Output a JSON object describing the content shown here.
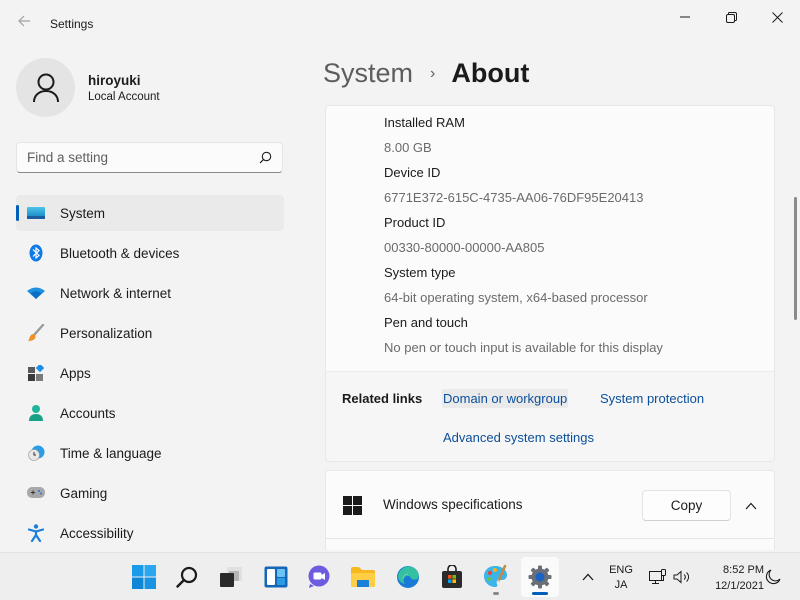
{
  "window": {
    "title": "Settings",
    "back_icon": "arrow-left-icon",
    "controls": {
      "minimize": "minimize-icon",
      "maximize": "restore-icon",
      "close": "close-icon"
    }
  },
  "profile": {
    "name": "hiroyuki",
    "account_type": "Local Account",
    "avatar_icon": "person-icon"
  },
  "search": {
    "placeholder": "Find a setting",
    "value": "",
    "icon": "search-icon"
  },
  "sidebar": {
    "items": [
      {
        "label": "System",
        "icon": "system-monitor-icon",
        "active": true
      },
      {
        "label": "Bluetooth & devices",
        "icon": "bluetooth-icon",
        "active": false
      },
      {
        "label": "Network & internet",
        "icon": "wifi-icon",
        "active": false
      },
      {
        "label": "Personalization",
        "icon": "paintbrush-icon",
        "active": false
      },
      {
        "label": "Apps",
        "icon": "apps-icon",
        "active": false
      },
      {
        "label": "Accounts",
        "icon": "accounts-icon",
        "active": false
      },
      {
        "label": "Time & language",
        "icon": "time-globe-icon",
        "active": false
      },
      {
        "label": "Gaming",
        "icon": "gamepad-icon",
        "active": false
      },
      {
        "label": "Accessibility",
        "icon": "accessibility-icon",
        "active": false
      }
    ]
  },
  "breadcrumb": {
    "parent": "System",
    "separator": "›",
    "current": "About"
  },
  "device_specs": [
    {
      "label": "Installed RAM",
      "value": "8.00 GB"
    },
    {
      "label": "Device ID",
      "value": "6771E372-615C-4735-AA06-76DF95E20413"
    },
    {
      "label": "Product ID",
      "value": "00330-80000-00000-AA805"
    },
    {
      "label": "System type",
      "value": "64-bit operating system, x64-based processor"
    },
    {
      "label": "Pen and touch",
      "value": "No pen or touch input is available for this display"
    }
  ],
  "related_links": {
    "label": "Related links",
    "links": [
      {
        "label": "Domain or workgroup",
        "hovered": true
      },
      {
        "label": "System protection",
        "hovered": false
      },
      {
        "label": "Advanced system settings",
        "hovered": false
      }
    ]
  },
  "windows_specifications": {
    "label": "Windows specifications",
    "icon": "windows-logo-icon",
    "copy_label": "Copy",
    "expanded": true,
    "collapse_icon": "chevron-up-icon"
  },
  "taskbar": {
    "apps": [
      {
        "name": "Start",
        "icon": "windows-start-icon",
        "state": "none"
      },
      {
        "name": "Search",
        "icon": "search-icon",
        "state": "none"
      },
      {
        "name": "Task View",
        "icon": "task-view-icon",
        "state": "none"
      },
      {
        "name": "Widgets",
        "icon": "widgets-icon",
        "state": "none"
      },
      {
        "name": "Chat",
        "icon": "teams-chat-icon",
        "state": "none"
      },
      {
        "name": "File Explorer",
        "icon": "folder-icon",
        "state": "none"
      },
      {
        "name": "Microsoft Edge",
        "icon": "edge-icon",
        "state": "none"
      },
      {
        "name": "Microsoft Store",
        "icon": "store-icon",
        "state": "none"
      },
      {
        "name": "Paint",
        "icon": "paint-palette-icon",
        "state": "running"
      },
      {
        "name": "Settings",
        "icon": "settings-gear-icon",
        "state": "focused"
      }
    ],
    "tray": {
      "overflow_icon": "chevron-up-icon",
      "ime_line1": "ENG",
      "ime_line2": "JA",
      "network_icon": "network-wired-icon",
      "volume_icon": "volume-icon",
      "time": "8:52 PM",
      "date": "12/1/2021",
      "focus_icon": "moon-icon"
    }
  },
  "colors": {
    "accent": "#005fb8",
    "link": "#0a4f9b",
    "background": "#f3f3f3",
    "card": "#fbfbfb"
  }
}
